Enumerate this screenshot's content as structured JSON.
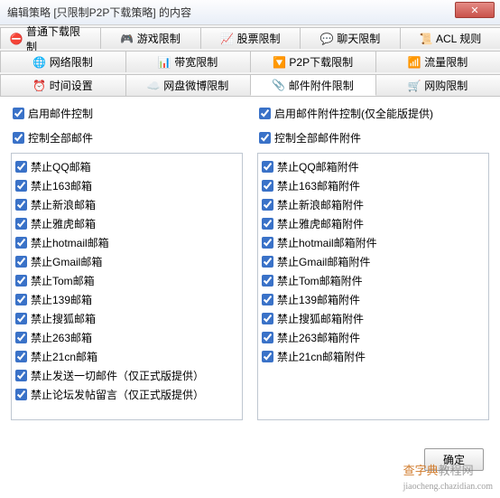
{
  "window": {
    "title": "编辑策略 [只限制P2P下载策略] 的内容",
    "close": "✕"
  },
  "tabs_row1": [
    {
      "icon": "⛔",
      "label": "普通下载限制",
      "name": "tab-download"
    },
    {
      "icon": "🎮",
      "label": "游戏限制",
      "name": "tab-game"
    },
    {
      "icon": "📈",
      "label": "股票限制",
      "name": "tab-stock"
    },
    {
      "icon": "💬",
      "label": "聊天限制",
      "name": "tab-chat"
    },
    {
      "icon": "📜",
      "label": "ACL 规则",
      "name": "tab-acl"
    }
  ],
  "tabs_row2": [
    {
      "icon": "🌐",
      "label": "网络限制",
      "name": "tab-network"
    },
    {
      "icon": "📊",
      "label": "带宽限制",
      "name": "tab-bandwidth"
    },
    {
      "icon": "🔽",
      "label": "P2P下载限制",
      "name": "tab-p2p"
    },
    {
      "icon": "📶",
      "label": "流量限制",
      "name": "tab-traffic"
    }
  ],
  "tabs_row3": [
    {
      "icon": "⏰",
      "label": "时间设置",
      "name": "tab-time"
    },
    {
      "icon": "☁️",
      "label": "网盘微博限制",
      "name": "tab-netdisk"
    },
    {
      "icon": "📎",
      "label": "邮件附件限制",
      "name": "tab-mail-attach",
      "active": true
    },
    {
      "icon": "🛒",
      "label": "网购限制",
      "name": "tab-shopping"
    }
  ],
  "left": {
    "enable": "启用邮件控制",
    "all": "控制全部邮件",
    "items": [
      "禁止QQ邮箱",
      "禁止163邮箱",
      "禁止新浪邮箱",
      "禁止雅虎邮箱",
      "禁止hotmail邮箱",
      "禁止Gmail邮箱",
      "禁止Tom邮箱",
      "禁止139邮箱",
      "禁止搜狐邮箱",
      "禁止263邮箱",
      "禁止21cn邮箱",
      "禁止发送一切邮件（仅正式版提供）",
      "禁止论坛发帖留言（仅正式版提供）"
    ]
  },
  "right": {
    "enable": "启用邮件附件控制(仅全能版提供)",
    "all": "控制全部邮件附件",
    "items": [
      "禁止QQ邮箱附件",
      "禁止163邮箱附件",
      "禁止新浪邮箱附件",
      "禁止雅虎邮箱附件",
      "禁止hotmail邮箱附件",
      "禁止Gmail邮箱附件",
      "禁止Tom邮箱附件",
      "禁止139邮箱附件",
      "禁止搜狐邮箱附件",
      "禁止263邮箱附件",
      "禁止21cn邮箱附件"
    ]
  },
  "footer": {
    "ok": "确定"
  },
  "watermark": {
    "a": "查字典",
    "b": "教程网",
    "url": "jiaocheng.chazidian.com"
  }
}
